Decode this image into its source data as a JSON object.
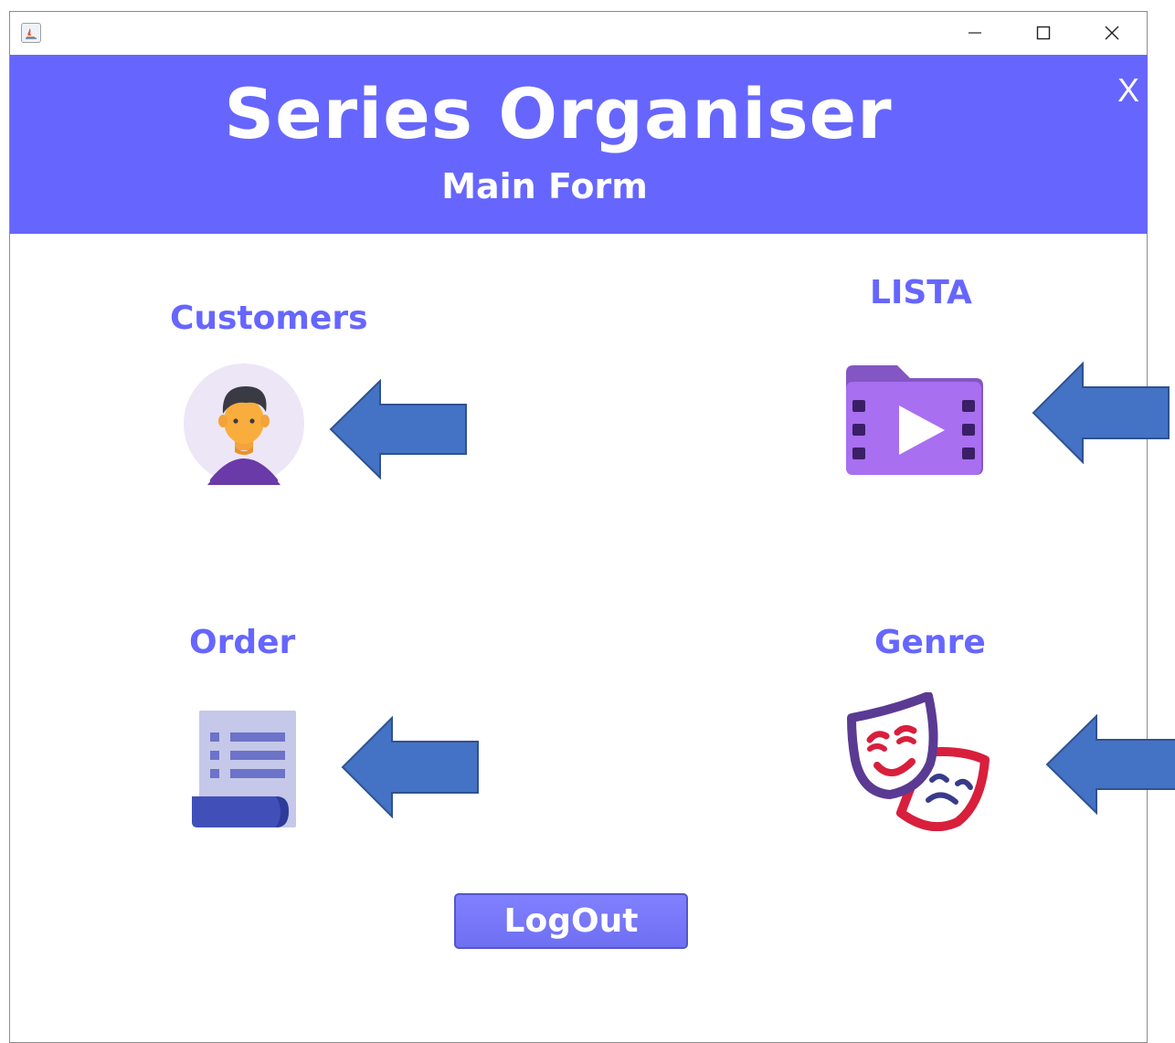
{
  "window": {
    "controls": {
      "minimize_icon": "minimize-icon",
      "maximize_icon": "maximize-icon",
      "close_icon": "close-icon"
    }
  },
  "header": {
    "title": "Series Organiser",
    "subtitle": "Main Form",
    "close_label": "X",
    "background": "#6666ff"
  },
  "tiles": {
    "customers": {
      "label": "Customers",
      "icon": "user-avatar-icon"
    },
    "lista": {
      "label": "LISTA",
      "icon": "video-folder-icon"
    },
    "order": {
      "label": "Order",
      "icon": "list-document-icon"
    },
    "genre": {
      "label": "Genre",
      "icon": "theater-masks-icon"
    }
  },
  "arrow_color": "#4472c4",
  "accent": "#6666ff",
  "logout": {
    "label": "LogOut"
  }
}
